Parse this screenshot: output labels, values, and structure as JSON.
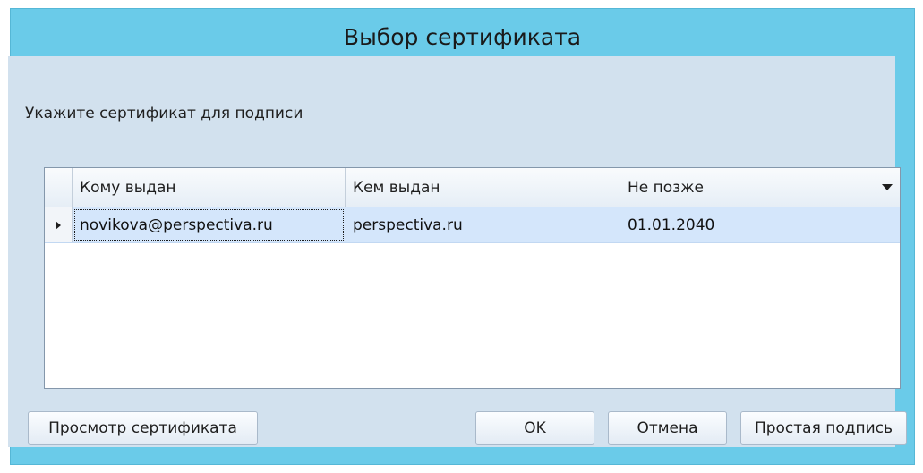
{
  "dialog": {
    "title": "Выбор сертификата",
    "instruction": "Укажите сертификат для подписи"
  },
  "grid": {
    "columns": [
      "Кому выдан",
      "Кем выдан",
      "Не позже"
    ],
    "rows": [
      {
        "issued_to": "novikova@perspectiva.ru",
        "issued_by": "perspectiva.ru",
        "not_after": "01.01.2040"
      }
    ]
  },
  "buttons": {
    "view_certificate": "Просмотр сертификата",
    "ok": "OK",
    "cancel": "Отмена",
    "simple_signature": "Простая подпись"
  },
  "icons": {
    "sort_dropdown": "chevron-down-icon",
    "row_pointer": "triangle-right-icon"
  },
  "colors": {
    "title_bar": "#6acbe9",
    "client_area": "#d2e1ee",
    "selected_row": "#d4e6fb"
  }
}
